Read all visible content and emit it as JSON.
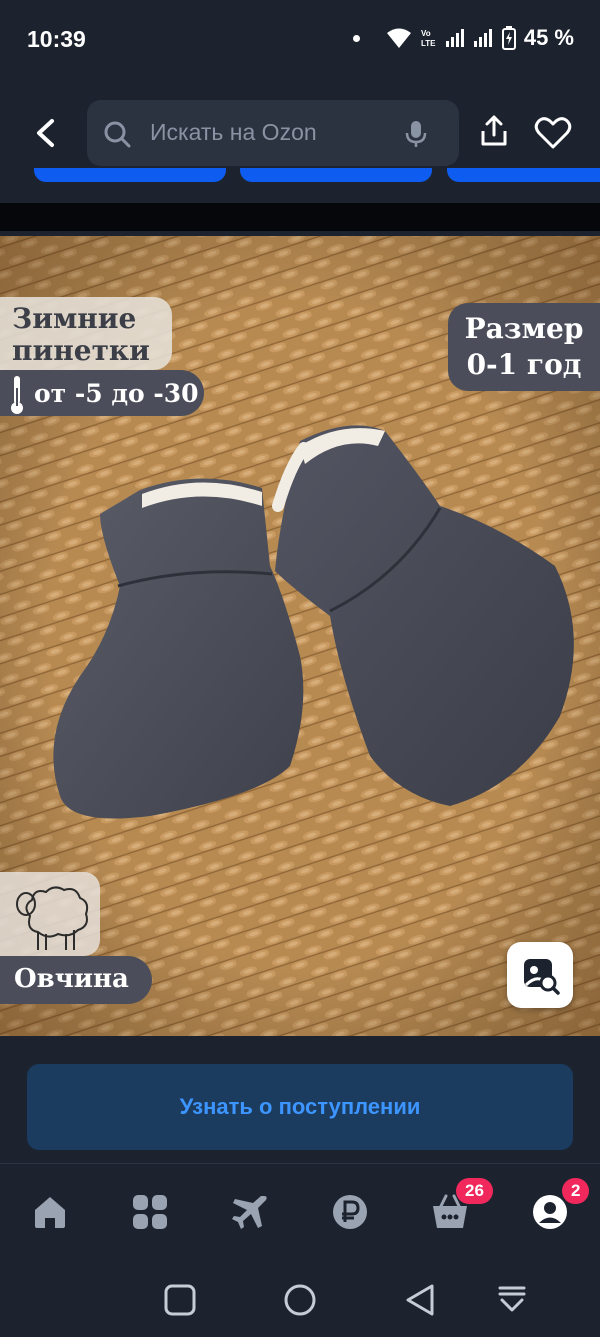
{
  "status_bar": {
    "time": "10:39",
    "battery": "45 %",
    "icons": [
      "notification-dot-icon",
      "wifi-icon",
      "volte-icon",
      "signal-icon",
      "signal-icon",
      "battery-icon"
    ]
  },
  "header": {
    "search_placeholder": "Искать на Ozon",
    "back_icon": "back-arrow-icon",
    "search_icon": "search-icon",
    "mic_icon": "microphone-icon",
    "share_icon": "share-icon",
    "favorite_icon": "heart-icon"
  },
  "product": {
    "badge_title": "Зимние пинетки",
    "badge_temperature": "от -5 до -30",
    "badge_size_line1": "Размер",
    "badge_size_line2": "0-1 год",
    "badge_material": "Овчина",
    "similar_search_icon": "image-search-icon"
  },
  "actions": {
    "notify_label": "Узнать о поступлении"
  },
  "tab_bar": {
    "items": [
      {
        "icon": "home-icon"
      },
      {
        "icon": "catalog-icon"
      },
      {
        "icon": "travel-plane-icon"
      },
      {
        "icon": "ruble-finance-icon"
      },
      {
        "icon": "cart-icon",
        "badge": "26"
      },
      {
        "icon": "profile-icon",
        "badge": "2"
      }
    ]
  },
  "system_nav": {
    "icons": [
      "recents-square-icon",
      "home-circle-icon",
      "back-triangle-icon",
      "notification-pull-icon"
    ]
  },
  "colors": {
    "background": "#1d232e",
    "search_box": "#2b3341",
    "accent_blue": "#0f5cf0",
    "notify_bg": "#1b3b5f",
    "notify_text": "#3d95ff",
    "badge_pink": "#f0285c"
  }
}
